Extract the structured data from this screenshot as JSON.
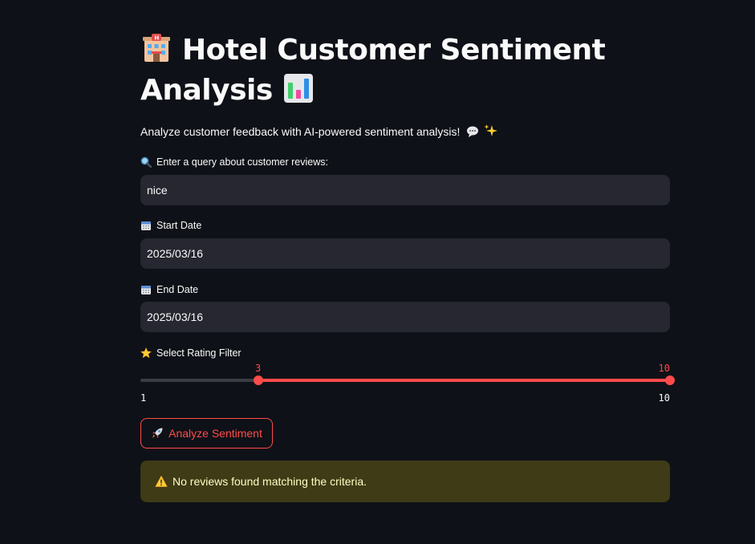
{
  "header": {
    "title": "Hotel Customer Sentiment Analysis",
    "subtitle": "Analyze customer feedback with AI-powered sentiment analysis!"
  },
  "query": {
    "label": "Enter a query about customer reviews:",
    "value": "nice"
  },
  "start_date": {
    "label": "Start Date",
    "value": "2025/03/16"
  },
  "end_date": {
    "label": "End Date",
    "value": "2025/03/16"
  },
  "rating_filter": {
    "label": "Select Rating Filter",
    "min": 1,
    "max": 10,
    "min_label": "1",
    "max_label": "10",
    "low": 3,
    "high": 10,
    "low_label": "3",
    "high_label": "10"
  },
  "analyze_button": {
    "label": "Analyze Sentiment",
    "icon": "rocket-icon"
  },
  "alert": {
    "text": "No reviews found matching the criteria.",
    "icon": "warning-icon"
  },
  "icons": {
    "title_lead": "hotel-icon",
    "title_trail": "bar-chart-icon",
    "subtitle_icons": [
      "speech-bubble-icon",
      "sparkles-icon"
    ],
    "query_label": "magnifier-icon",
    "date_label": "calendar-icon",
    "rating_label": "star-icon"
  },
  "colors": {
    "background": "#0e1117",
    "input_bg": "#262730",
    "accent": "#ff4b4b",
    "track": "#3b3d45",
    "alert_bg": "#3e3b16",
    "alert_text": "#ffffc2"
  }
}
